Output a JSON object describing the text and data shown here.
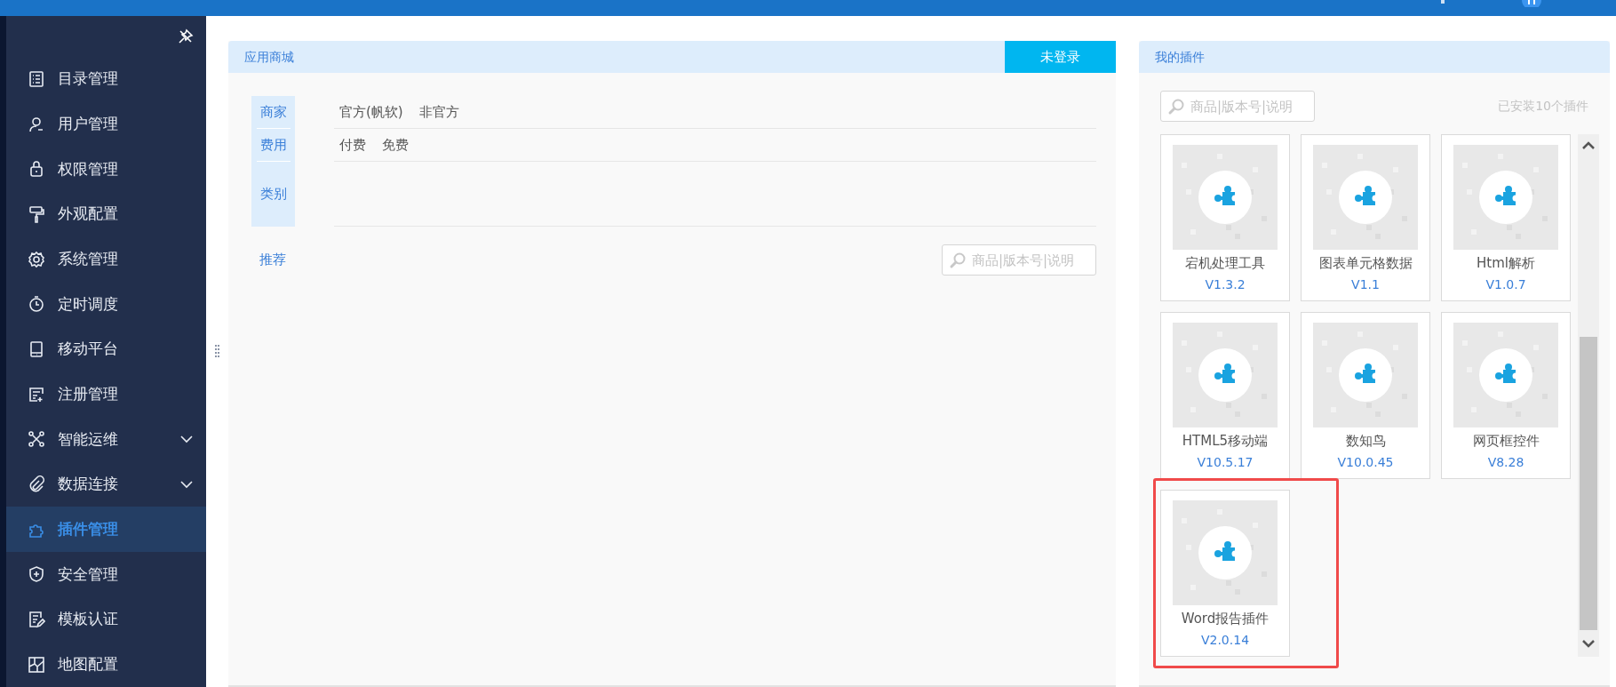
{
  "sidebar": {
    "items": [
      {
        "label": "目录管理",
        "selected": false,
        "expandable": false
      },
      {
        "label": "用户管理",
        "selected": false,
        "expandable": false
      },
      {
        "label": "权限管理",
        "selected": false,
        "expandable": false
      },
      {
        "label": "外观配置",
        "selected": false,
        "expandable": false
      },
      {
        "label": "系统管理",
        "selected": false,
        "expandable": false
      },
      {
        "label": "定时调度",
        "selected": false,
        "expandable": false
      },
      {
        "label": "移动平台",
        "selected": false,
        "expandable": false
      },
      {
        "label": "注册管理",
        "selected": false,
        "expandable": false
      },
      {
        "label": "智能运维",
        "selected": false,
        "expandable": true
      },
      {
        "label": "数据连接",
        "selected": false,
        "expandable": true
      },
      {
        "label": "插件管理",
        "selected": true,
        "expandable": false
      },
      {
        "label": "安全管理",
        "selected": false,
        "expandable": false
      },
      {
        "label": "模板认证",
        "selected": false,
        "expandable": false
      },
      {
        "label": "地图配置",
        "selected": false,
        "expandable": false
      }
    ]
  },
  "store": {
    "title": "应用商城",
    "login_button": "未登录",
    "filters": [
      {
        "label": "商家",
        "options": [
          "官方(帆软)",
          "非官方"
        ]
      },
      {
        "label": "费用",
        "options": [
          "付费",
          "免费"
        ]
      },
      {
        "label": "类别"
      }
    ],
    "recommend_label": "推荐",
    "search": {
      "placeholder": "商品|版本号|说明"
    }
  },
  "my_plugins": {
    "title": "我的插件",
    "search": {
      "placeholder": "商品|版本号|说明"
    },
    "installed_count": "已安装10个插件",
    "plugins": [
      {
        "name": "宕机处理工具",
        "version": "V1.3.2",
        "highlighted": false
      },
      {
        "name": "图表单元格数据",
        "version": "V1.1",
        "highlighted": false
      },
      {
        "name": "Html解析",
        "version": "V1.0.7",
        "highlighted": false
      },
      {
        "name": "HTML5移动端",
        "version": "V10.5.17",
        "highlighted": false
      },
      {
        "name": "数知鸟",
        "version": "V10.0.45",
        "highlighted": false
      },
      {
        "name": "网页框控件",
        "version": "V8.28",
        "highlighted": false
      },
      {
        "name": "Word报告插件",
        "version": "V2.0.14",
        "highlighted": true
      }
    ]
  }
}
